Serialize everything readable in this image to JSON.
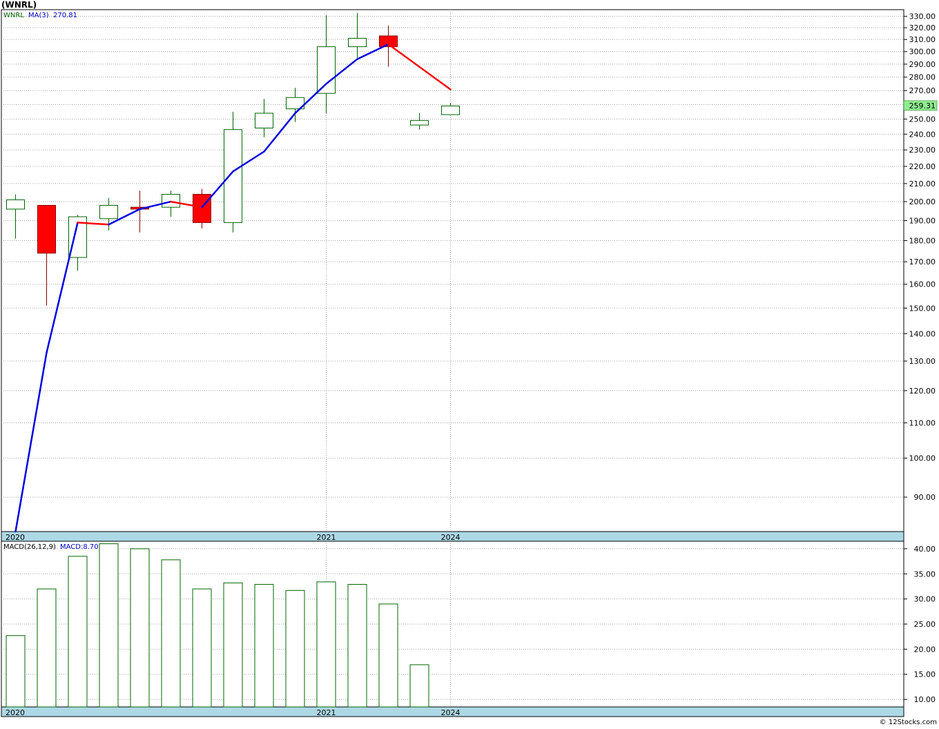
{
  "title": "(WNRL)",
  "credit": "© 12Stocks.com",
  "colors": {
    "up_candle": "#006400",
    "down_candle": "#ff0000",
    "ma_up": "#0000e0",
    "ma_down": "#ff0000",
    "grid": "#a0a0a0",
    "axis_band": "#add8e6",
    "last_price_bg": "#90ee90"
  },
  "chart_data": [
    {
      "type": "candlestick",
      "panel": "price",
      "legend": {
        "symbol": "WNRL",
        "ma_label": "MA(3)",
        "ma_value": "270.81"
      },
      "last_price_label": "259.31",
      "yscale": "log",
      "ylim": [
        82,
        336
      ],
      "y_ticks": [
        90,
        100,
        110,
        120,
        130,
        140,
        150,
        160,
        170,
        180,
        190,
        200,
        210,
        220,
        230,
        240,
        250,
        260,
        270,
        280,
        290,
        300,
        310,
        320,
        330
      ],
      "x_tick_labels": [
        {
          "label": "2020",
          "index": 0
        },
        {
          "label": "2021",
          "index": 10
        },
        {
          "label": "2024",
          "index": 14
        }
      ],
      "candles": [
        {
          "o": 196,
          "h": 204,
          "l": 181,
          "c": 201
        },
        {
          "o": 198,
          "h": 198,
          "l": 151,
          "c": 174
        },
        {
          "o": 172,
          "h": 193,
          "l": 166,
          "c": 192
        },
        {
          "o": 191,
          "h": 202,
          "l": 185,
          "c": 198
        },
        {
          "o": 197,
          "h": 206,
          "l": 184,
          "c": 196
        },
        {
          "o": 197,
          "h": 206,
          "l": 192,
          "c": 204
        },
        {
          "o": 204,
          "h": 207,
          "l": 186,
          "c": 189
        },
        {
          "o": 189,
          "h": 255,
          "l": 184,
          "c": 243
        },
        {
          "o": 244,
          "h": 264,
          "l": 238,
          "c": 254
        },
        {
          "o": 257,
          "h": 272,
          "l": 248,
          "c": 265
        },
        {
          "o": 268,
          "h": 331,
          "l": 254,
          "c": 304
        },
        {
          "o": 304,
          "h": 333,
          "l": 295,
          "c": 311
        },
        {
          "o": 313,
          "h": 322,
          "l": 288,
          "c": 304
        },
        {
          "o": 246,
          "h": 254,
          "l": 243,
          "c": 249
        },
        {
          "o": 253,
          "h": 261,
          "l": 253,
          "c": 259
        }
      ],
      "ma": [
        82,
        133,
        189,
        188,
        196,
        200,
        197,
        217,
        229,
        254,
        275,
        294,
        306,
        null,
        270.81
      ]
    },
    {
      "type": "bar",
      "panel": "macd",
      "legend": {
        "label": "MACD(26,12,9)",
        "value_label": "MACD:8.70"
      },
      "ylim": [
        8.5,
        41.5
      ],
      "y_ticks": [
        10,
        15,
        20,
        25,
        30,
        35,
        40
      ],
      "x_tick_labels": [
        {
          "label": "2020",
          "index": 0
        },
        {
          "label": "2021",
          "index": 10
        },
        {
          "label": "2024",
          "index": 14
        }
      ],
      "values": [
        22.7,
        32.0,
        38.5,
        41.0,
        40.0,
        37.8,
        32.0,
        33.2,
        32.9,
        31.7,
        33.4,
        32.9,
        29.0,
        16.9
      ]
    }
  ]
}
